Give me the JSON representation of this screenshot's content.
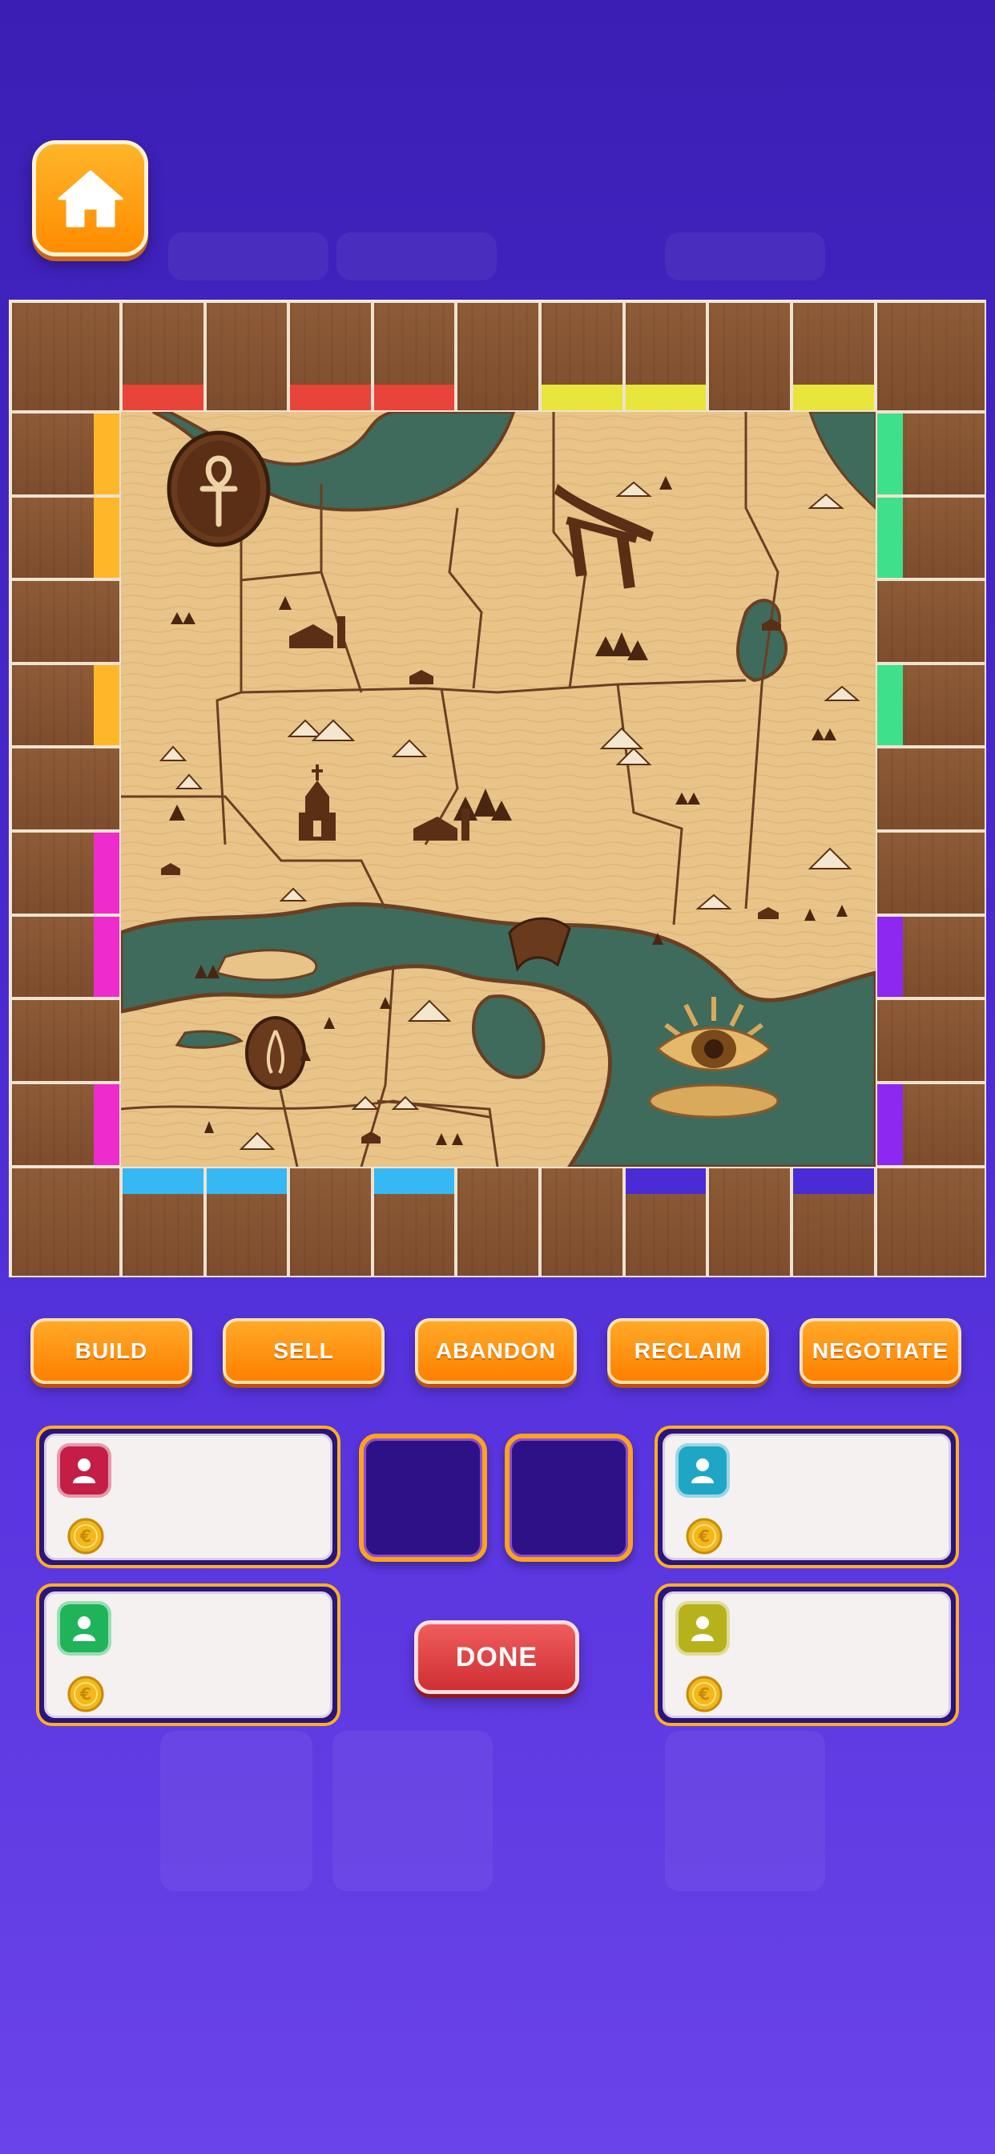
{
  "home": {
    "icon": "home-icon"
  },
  "actions": {
    "build": "BUILD",
    "sell": "SELL",
    "abandon": "ABANDON",
    "reclaim": "RECLAIM",
    "negotiate": "NEGOTIATE"
  },
  "done_label": "DONE",
  "players": [
    {
      "id": "red",
      "color": "#c41e46",
      "icon": "user-icon",
      "currency_icon": "coin-icon"
    },
    {
      "id": "teal",
      "color": "#1fa6c4",
      "icon": "user-icon",
      "currency_icon": "coin-icon"
    },
    {
      "id": "green",
      "color": "#1fb45a",
      "icon": "user-icon",
      "currency_icon": "coin-icon"
    },
    {
      "id": "olive",
      "color": "#b7b21b",
      "icon": "user-icon",
      "currency_icon": "coin-icon"
    }
  ],
  "property_colors": {
    "red": "#e8443a",
    "yellow": "#e8e53c",
    "orange": "#ffb628",
    "mint": "#3ee08c",
    "magenta": "#ee2ccd",
    "purple": "#8d28f0",
    "sky": "#35b8f3",
    "indigo": "#4b2bd6"
  },
  "map_icons": [
    "ankh-icon",
    "torii-gate-icon",
    "church-icon",
    "praying-hands-icon",
    "eye-icon",
    "bridge-icon"
  ]
}
